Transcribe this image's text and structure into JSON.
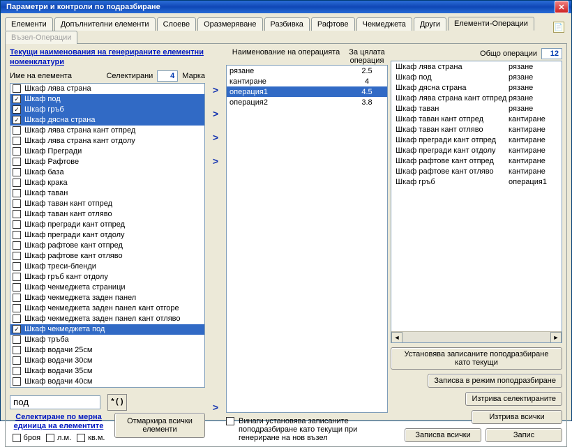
{
  "title": "Параметри и контроли по подразбиране",
  "tabs": [
    "Елементи",
    "Допълнителни елементи",
    "Слоеве",
    "Оразмеряване",
    "Разбивка",
    "Рафтове",
    "Чекмеджета",
    "Други",
    "Елементи-Операции",
    "Възел-Операции"
  ],
  "active_tab": 8,
  "disabled_tabs": [
    9
  ],
  "left": {
    "header_link": "Текущи наименования на генерираните елементни номенклатури",
    "name_lbl": "Име на елемента",
    "sel_lbl": "Селектирани",
    "sel_count": "4",
    "mark_lbl": "Марка",
    "items": [
      {
        "t": "Шкаф лява страна",
        "c": false,
        "s": false
      },
      {
        "t": "Шкаф под",
        "c": true,
        "s": true
      },
      {
        "t": "Шкаф гръб",
        "c": true,
        "s": true
      },
      {
        "t": "Шкаф дясна страна",
        "c": true,
        "s": true
      },
      {
        "t": "Шкаф лява страна кант отпред",
        "c": false,
        "s": false
      },
      {
        "t": "Шкаф лява страна кант отдолу",
        "c": false,
        "s": false
      },
      {
        "t": "Шкаф Прегради",
        "c": false,
        "s": false
      },
      {
        "t": "Шкаф Рафтове",
        "c": false,
        "s": false
      },
      {
        "t": "Шкаф база",
        "c": false,
        "s": false
      },
      {
        "t": "Шкаф крака",
        "c": false,
        "s": false
      },
      {
        "t": "Шкаф таван",
        "c": false,
        "s": false
      },
      {
        "t": "Шкаф таван кант отпред",
        "c": false,
        "s": false
      },
      {
        "t": "Шкаф таван кант отляво",
        "c": false,
        "s": false
      },
      {
        "t": "Шкаф прегради кант отпред",
        "c": false,
        "s": false
      },
      {
        "t": "Шкаф прегради кант отдолу",
        "c": false,
        "s": false
      },
      {
        "t": "Шкаф рафтове кант отпред",
        "c": false,
        "s": false
      },
      {
        "t": "Шкаф рафтове кант отляво",
        "c": false,
        "s": false
      },
      {
        "t": "Шкаф треси-бленди",
        "c": false,
        "s": false
      },
      {
        "t": "Шкаф гръб кант отдолу",
        "c": false,
        "s": false
      },
      {
        "t": "Шкаф чекмеджета страници",
        "c": false,
        "s": false
      },
      {
        "t": "Шкаф чекмеджета заден панел",
        "c": false,
        "s": false
      },
      {
        "t": "Шкаф чекмеджета заден панел кант отгоре",
        "c": false,
        "s": false
      },
      {
        "t": "Шкаф чекмеджета заден панел кант отляво",
        "c": false,
        "s": false
      },
      {
        "t": "Шкаф чекмеджета под",
        "c": true,
        "s": true
      },
      {
        "t": "Шкаф тръба",
        "c": false,
        "s": false
      },
      {
        "t": "Шкаф водачи 25см",
        "c": false,
        "s": false
      },
      {
        "t": "Шкаф водачи 30см",
        "c": false,
        "s": false
      },
      {
        "t": "Шкаф водачи 35см",
        "c": false,
        "s": false
      },
      {
        "t": "Шкаф водачи 40см",
        "c": false,
        "s": false
      }
    ],
    "search_value": "под",
    "search_icon_label": "*()",
    "select_units_link": "Селектиране по мерна единица на елементите",
    "unit_opts": [
      "броя",
      "л.м.",
      "кв.м."
    ],
    "unmark_btn": "Отмаркира всички елементи"
  },
  "mid": {
    "name_col": "Наименование на операцията",
    "all_col": "За цялата операция",
    "rows": [
      {
        "n": "рязане",
        "v": "2.5",
        "s": false
      },
      {
        "n": "кантиране",
        "v": "4",
        "s": false
      },
      {
        "n": "операция1",
        "v": "4.5",
        "s": true
      },
      {
        "n": "операция2",
        "v": "3.8",
        "s": false
      }
    ],
    "always_set_lbl": "Винаги установява записаните поподразбиране като текущи при генериране на нов възел"
  },
  "right": {
    "total_lbl": "Общо операции",
    "total_count": "12",
    "rows": [
      {
        "n": "Шкаф лява страна",
        "o": "рязане"
      },
      {
        "n": "Шкаф под",
        "o": "рязане"
      },
      {
        "n": "Шкаф дясна страна",
        "o": "рязане"
      },
      {
        "n": "Шкаф лява страна кант отпред",
        "o": "рязане"
      },
      {
        "n": "Шкаф таван",
        "o": "рязане"
      },
      {
        "n": "Шкаф таван кант отпред",
        "o": "кантиране"
      },
      {
        "n": "Шкаф таван кант отляво",
        "o": "кантиране"
      },
      {
        "n": "Шкаф прегради кант отпред",
        "o": "кантиране"
      },
      {
        "n": "Шкаф прегради кант отдолу",
        "o": "кантиране"
      },
      {
        "n": "Шкаф рафтове кант отпред",
        "o": "кантиране"
      },
      {
        "n": "Шкаф рафтове кант отляво",
        "o": "кантиране"
      },
      {
        "n": "Шкаф гръб",
        "o": "операция1"
      }
    ],
    "btns": {
      "set_default": "Установява записаните поподразбиране като текущи",
      "save_default": "Записва в режим поподразбиране",
      "delete_sel": "Изтрива селектираните",
      "delete_all": "Изтрива всички",
      "save_all": "Записва всички",
      "save": "Запис"
    }
  }
}
